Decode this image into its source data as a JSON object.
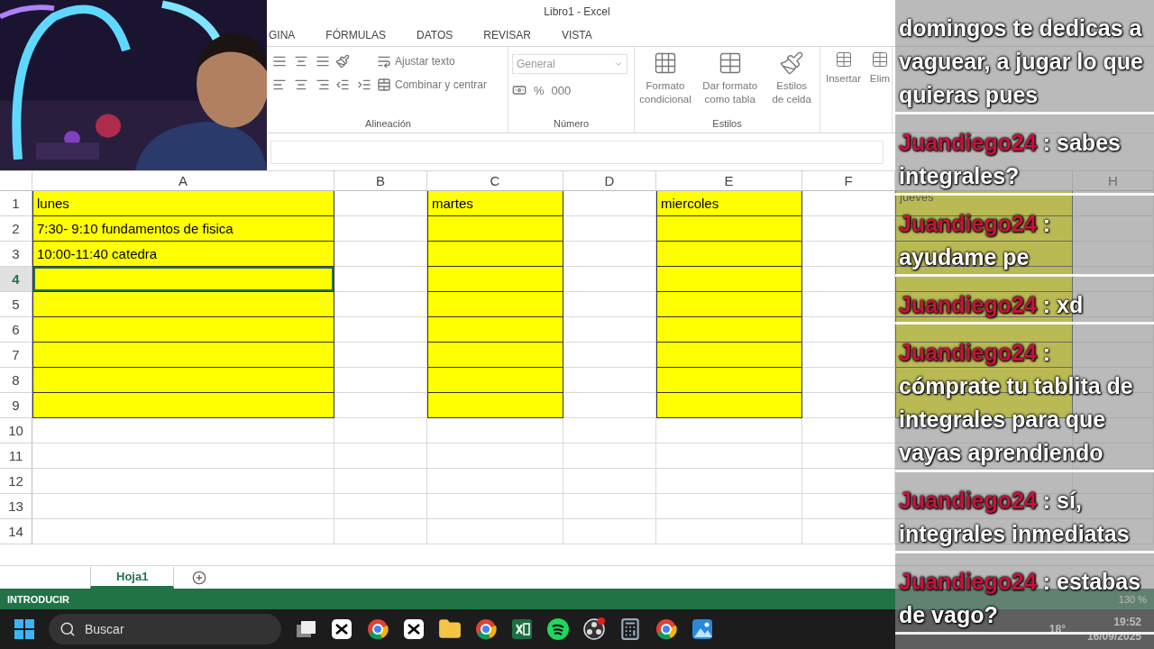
{
  "window": {
    "title": "Libro1 - Excel"
  },
  "ribbon_tabs": [
    {
      "label": "GINA",
      "selected": false
    },
    {
      "label": "FÓRMULAS",
      "selected": false
    },
    {
      "label": "DATOS",
      "selected": false
    },
    {
      "label": "REVISAR",
      "selected": false
    },
    {
      "label": "VISTA",
      "selected": false
    }
  ],
  "alignment": {
    "label": "Alineación",
    "wrap_text": "Ajustar texto",
    "merge_center": "Combinar y centrar"
  },
  "number": {
    "label": "Número",
    "format": "General",
    "percent": "%",
    "thousands": "000"
  },
  "styles": {
    "label": "Estilos",
    "buttons": [
      "Formato condicional",
      "Dar formato como tabla",
      "Estilos de celda"
    ]
  },
  "cells_group": {
    "buttons": [
      "Insertar",
      "Elim"
    ]
  },
  "sheet": {
    "columns": [
      {
        "label": "A"
      },
      {
        "label": "B"
      },
      {
        "label": "C"
      },
      {
        "label": "D"
      },
      {
        "label": "E"
      },
      {
        "label": "F"
      },
      {},
      {
        "label": "H"
      }
    ],
    "rows": [
      {
        "number": "1",
        "cells": [
          {
            "text": "lunes",
            "filled": true,
            "selected": false
          },
          {
            "filled": false,
            "selected": false
          },
          {
            "text": "martes",
            "filled": true,
            "selected": false
          },
          {
            "filled": false,
            "selected": false
          },
          {
            "text": "miercoles",
            "filled": true,
            "selected": false
          },
          {
            "filled": false,
            "selected": false
          },
          {
            "text": "jueves",
            "filled": true,
            "selected": false
          },
          {
            "filled": false,
            "selected": false
          }
        ]
      },
      {
        "number": "2",
        "cells": [
          {
            "text": "7:30- 9:10 fundamentos de fisica",
            "filled": true,
            "selected": false
          },
          {
            "filled": false,
            "selected": false
          },
          {
            "filled": true,
            "selected": false
          },
          {
            "filled": false,
            "selected": false
          },
          {
            "filled": true,
            "selected": false
          },
          {
            "filled": false,
            "selected": false
          },
          {
            "filled": true,
            "selected": false
          },
          {
            "filled": false,
            "selected": false
          }
        ]
      },
      {
        "number": "3",
        "cells": [
          {
            "text": "10:00-11:40 catedra",
            "filled": true,
            "selected": false
          },
          {
            "filled": false,
            "selected": false
          },
          {
            "filled": true,
            "selected": false
          },
          {
            "filled": false,
            "selected": false
          },
          {
            "filled": true,
            "selected": false
          },
          {
            "filled": false,
            "selected": false
          },
          {
            "filled": true,
            "selected": false
          },
          {
            "filled": false,
            "selected": false
          }
        ]
      },
      {
        "number": "4",
        "cells": [
          {
            "filled": true,
            "selected": true
          },
          {
            "filled": false,
            "selected": false
          },
          {
            "filled": true,
            "selected": false
          },
          {
            "filled": false,
            "selected": false
          },
          {
            "filled": true,
            "selected": false
          },
          {
            "filled": false,
            "selected": false
          },
          {
            "filled": true,
            "selected": false
          },
          {
            "filled": false,
            "selected": false
          }
        ]
      },
      {
        "number": "5",
        "cells": [
          {
            "filled": true,
            "selected": false
          },
          {
            "filled": false,
            "selected": false
          },
          {
            "filled": true,
            "selected": false
          },
          {
            "filled": false,
            "selected": false
          },
          {
            "filled": true,
            "selected": false
          },
          {
            "filled": false,
            "selected": false
          },
          {
            "filled": true,
            "selected": false
          },
          {
            "filled": false,
            "selected": false
          }
        ]
      },
      {
        "number": "6",
        "cells": [
          {
            "filled": true,
            "selected": false
          },
          {
            "filled": false,
            "selected": false
          },
          {
            "filled": true,
            "selected": false
          },
          {
            "filled": false,
            "selected": false
          },
          {
            "filled": true,
            "selected": false
          },
          {
            "filled": false,
            "selected": false
          },
          {
            "filled": true,
            "selected": false
          },
          {
            "filled": false,
            "selected": false
          }
        ]
      },
      {
        "number": "7",
        "cells": [
          {
            "filled": true,
            "selected": false
          },
          {
            "filled": false,
            "selected": false
          },
          {
            "filled": true,
            "selected": false
          },
          {
            "filled": false,
            "selected": false
          },
          {
            "filled": true,
            "selected": false
          },
          {
            "filled": false,
            "selected": false
          },
          {
            "filled": true,
            "selected": false
          },
          {
            "filled": false,
            "selected": false
          }
        ]
      },
      {
        "number": "8",
        "cells": [
          {
            "filled": true,
            "selected": false
          },
          {
            "filled": false,
            "selected": false
          },
          {
            "filled": true,
            "selected": false
          },
          {
            "filled": false,
            "selected": false
          },
          {
            "filled": true,
            "selected": false
          },
          {
            "filled": false,
            "selected": false
          },
          {
            "filled": true,
            "selected": false
          },
          {
            "filled": false,
            "selected": false
          }
        ]
      },
      {
        "number": "9",
        "cells": [
          {
            "filled": true,
            "selected": false
          },
          {
            "filled": false,
            "selected": false
          },
          {
            "filled": true,
            "selected": false
          },
          {
            "filled": false,
            "selected": false
          },
          {
            "filled": true,
            "selected": false
          },
          {
            "filled": false,
            "selected": false
          },
          {
            "filled": true,
            "selected": false
          },
          {
            "filled": false,
            "selected": false
          }
        ]
      },
      {
        "number": "10",
        "cells": [
          {
            "filled": false,
            "selected": false
          },
          {
            "filled": false,
            "selected": false
          },
          {
            "filled": false,
            "selected": false
          },
          {
            "filled": false,
            "selected": false
          },
          {
            "filled": false,
            "selected": false
          },
          {
            "filled": false,
            "selected": false
          },
          {
            "filled": false,
            "selected": false
          },
          {
            "filled": false,
            "selected": false
          }
        ]
      },
      {
        "number": "11",
        "cells": [
          {
            "filled": false,
            "selected": false
          },
          {
            "filled": false,
            "selected": false
          },
          {
            "filled": false,
            "selected": false
          },
          {
            "filled": false,
            "selected": false
          },
          {
            "filled": false,
            "selected": false
          },
          {
            "filled": false,
            "selected": false
          },
          {
            "filled": false,
            "selected": false
          },
          {
            "filled": false,
            "selected": false
          }
        ]
      },
      {
        "number": "12",
        "cells": [
          {
            "filled": false,
            "selected": false
          },
          {
            "filled": false,
            "selected": false
          },
          {
            "filled": false,
            "selected": false
          },
          {
            "filled": false,
            "selected": false
          },
          {
            "filled": false,
            "selected": false
          },
          {
            "filled": false,
            "selected": false
          },
          {
            "filled": false,
            "selected": false
          },
          {
            "filled": false,
            "selected": false
          }
        ]
      },
      {
        "number": "13",
        "cells": [
          {
            "filled": false,
            "selected": false
          },
          {
            "filled": false,
            "selected": false
          },
          {
            "filled": false,
            "selected": false
          },
          {
            "filled": false,
            "selected": false
          },
          {
            "filled": false,
            "selected": false
          },
          {
            "filled": false,
            "selected": false
          },
          {
            "filled": false,
            "selected": false
          },
          {
            "filled": false,
            "selected": false
          }
        ]
      },
      {
        "number": "14",
        "cells": [
          {
            "filled": false,
            "selected": false
          },
          {
            "filled": false,
            "selected": false
          },
          {
            "filled": false,
            "selected": false
          },
          {
            "filled": false,
            "selected": false
          },
          {
            "filled": false,
            "selected": false
          },
          {
            "filled": false,
            "selected": false
          },
          {
            "filled": false,
            "selected": false
          },
          {
            "filled": false,
            "selected": false
          }
        ]
      }
    ]
  },
  "sheet_tabs": [
    {
      "label": "Hoja1",
      "selected": true
    }
  ],
  "status_bar": {
    "mode": "INTRODUCIR",
    "zoom": "130 %"
  },
  "taskbar": {
    "search_placeholder": "Buscar",
    "temperature": "18°",
    "time": "19:52",
    "date": "16/09/2025"
  },
  "chat": [
    {
      "text": "domingos te dedicas a vaguear, a jugar lo que quieras pues"
    },
    {
      "user": "Juandiego24",
      "text": ": sabes integrales?"
    },
    {
      "user": "Juandiego24",
      "text": ": ayudame pe"
    },
    {
      "user": "Juandiego24",
      "text": ": xd"
    },
    {
      "user": "Juandiego24",
      "text": ": cómprate tu tablita de integrales para que vayas aprendiendo"
    },
    {
      "user": "Juandiego24",
      "text": ": sí, integrales inmediatas"
    },
    {
      "user": "Juandiego24",
      "text": ": estabas de vago?"
    }
  ]
}
